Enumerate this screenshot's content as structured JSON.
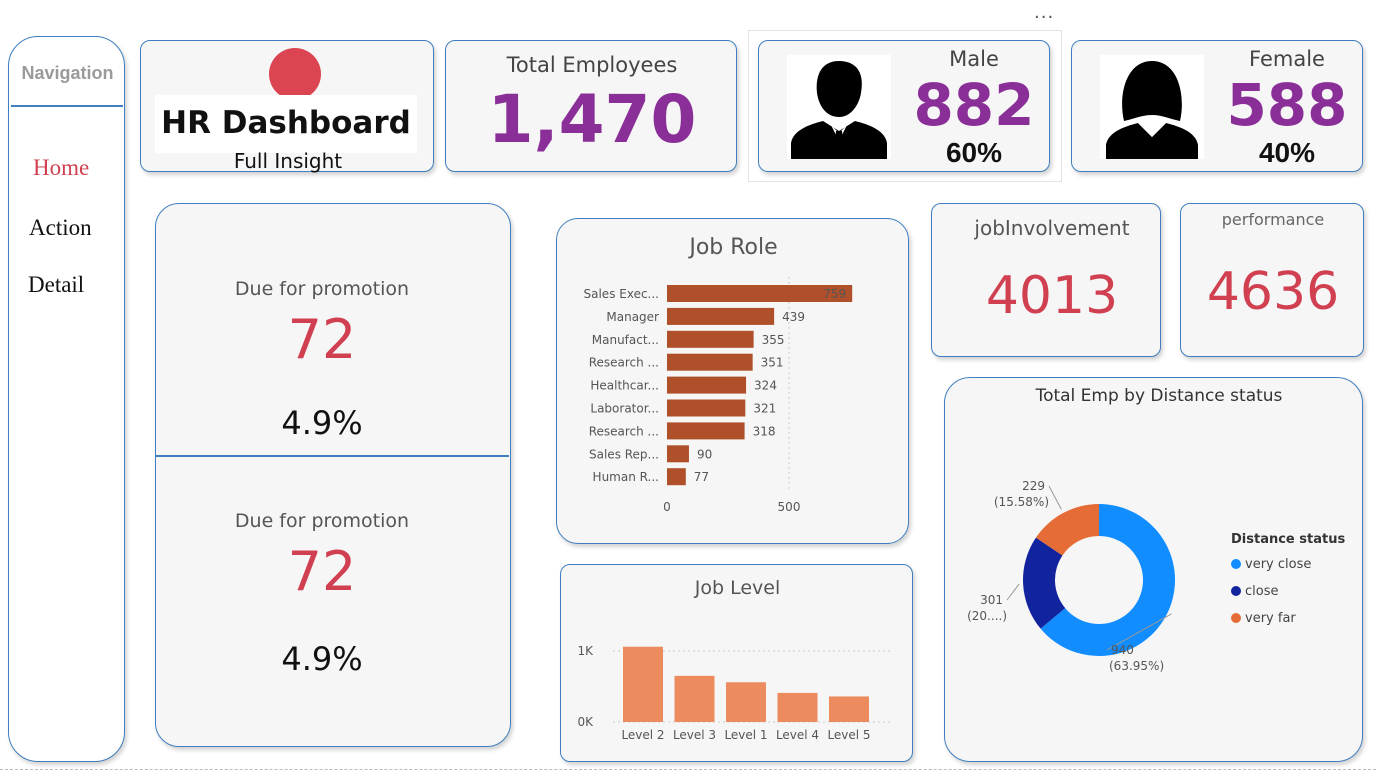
{
  "top_menu": {
    "more_label": "..."
  },
  "navigation": {
    "title": "Navigation",
    "items": [
      {
        "label": "Home",
        "active": true
      },
      {
        "label": "Action",
        "active": false
      },
      {
        "label": "Detail",
        "active": false
      }
    ]
  },
  "header": {
    "title": "HR Dashboard",
    "subtitle": "Full Insight",
    "dot_color": "#db4451"
  },
  "kpi": {
    "total_employees": {
      "label": "Total Employees",
      "value": "1,470"
    },
    "male": {
      "label": "Male",
      "value": "882",
      "percent": "60%",
      "icon": "male-avatar-icon"
    },
    "female": {
      "label": "Female",
      "value": "588",
      "percent": "40%",
      "icon": "female-avatar-icon"
    },
    "job_involvement": {
      "label": "jobInvolvement",
      "value": "4013"
    },
    "performance": {
      "label": "performance",
      "value": "4636"
    }
  },
  "promotion": [
    {
      "label": "Due for promotion",
      "value": "72",
      "percent": "4.9%"
    },
    {
      "label": "Due for promotion",
      "value": "72",
      "percent": "4.9%"
    }
  ],
  "colors": {
    "accent_purple": "#8a2f98",
    "accent_red": "#d04050",
    "border_blue": "#3f7fbf",
    "bar_brown": "#b0502a",
    "bar_orange": "#ec8b5e"
  },
  "chart_data": [
    {
      "type": "bar",
      "orientation": "horizontal",
      "title": "Job Role",
      "categories": [
        "Sales Exec...",
        "Manager",
        "Manufact...",
        "Research ...",
        "Healthcar...",
        "Laborator...",
        "Research ...",
        "Sales Rep...",
        "Human R..."
      ],
      "values": [
        759,
        439,
        355,
        351,
        324,
        321,
        318,
        90,
        77
      ],
      "x_ticks": [
        "0",
        "500"
      ],
      "xlim": [
        0,
        900
      ],
      "color": "#b0502a",
      "grid": false
    },
    {
      "type": "bar",
      "title": "Job Level",
      "categories": [
        "Level 2",
        "Level 3",
        "Level 1",
        "Level 4",
        "Level 5"
      ],
      "values": [
        1060,
        650,
        560,
        410,
        360
      ],
      "y_ticks": [
        "0K",
        "1K"
      ],
      "ylim": [
        0,
        1000
      ],
      "color": "#ec8b5e",
      "grid": true
    },
    {
      "type": "pie",
      "style": "donut",
      "title": "Total Emp by Distance status",
      "legend_title": "Distance status",
      "legend_position": "right",
      "slices": [
        {
          "name": "very close",
          "value": 940,
          "label_value": "940",
          "label_pct": "(63.95%)",
          "color": "#118dff"
        },
        {
          "name": "close",
          "value": 301,
          "label_value": "301",
          "label_pct": "(20....)",
          "color": "#12239e"
        },
        {
          "name": "very far",
          "value": 229,
          "label_value": "229",
          "label_pct": "(15.58%)",
          "color": "#e66c37"
        }
      ]
    }
  ]
}
